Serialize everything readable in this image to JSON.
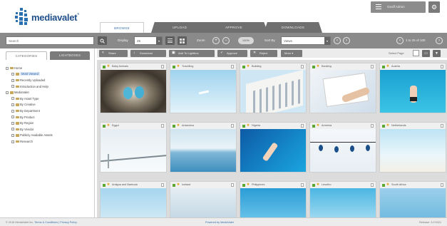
{
  "app": {
    "logo_text": "mediavalet",
    "logo_tm": "®"
  },
  "header": {
    "user_menu_label": "Geoff Admin",
    "tabs": [
      {
        "label": "BROWSE",
        "active": true
      },
      {
        "label": "UPLOAD",
        "active": false
      },
      {
        "label": "APPROVE",
        "active": false
      },
      {
        "label": "DOWNLOADS",
        "active": false
      }
    ]
  },
  "toolbar": {
    "search_placeholder": "Search",
    "display_label": "Display",
    "display_value": "25",
    "zoom_label": "Zoom",
    "zoom_value": "100%",
    "sort_label": "Sort By",
    "sort_value": "Views",
    "paging": "1 to 25 of 100"
  },
  "sidebar": {
    "tabs": [
      {
        "label": "CATEGORIES",
        "active": true
      },
      {
        "label": "LIGHTBOXES",
        "active": false
      }
    ],
    "tree": [
      {
        "label": "Home",
        "level": 0,
        "selected": false
      },
      {
        "label": "Most Viewed",
        "level": 1,
        "selected": true
      },
      {
        "label": "Recently Uploaded",
        "level": 1,
        "selected": false
      },
      {
        "label": "Introduction and Help",
        "level": 1,
        "selected": false
      },
      {
        "label": "MediaValet",
        "level": 0,
        "selected": false
      },
      {
        "label": "By Asset Type",
        "level": 1,
        "selected": false
      },
      {
        "label": "By Creative",
        "level": 1,
        "selected": false
      },
      {
        "label": "By Department",
        "level": 1,
        "selected": false
      },
      {
        "label": "By Product",
        "level": 1,
        "selected": false
      },
      {
        "label": "By Region",
        "level": 1,
        "selected": false
      },
      {
        "label": "By Vendor",
        "level": 1,
        "selected": false
      },
      {
        "label": "Publicly Available Assets",
        "level": 1,
        "selected": false
      },
      {
        "label": "Research",
        "level": 1,
        "selected": false
      }
    ]
  },
  "actions": {
    "buttons": [
      {
        "label": "Share",
        "icon": "share-icon",
        "glyph": "<"
      },
      {
        "label": "Download",
        "icon": "download-icon",
        "glyph": "↓"
      },
      {
        "label": "Add To Lightbox",
        "icon": "lightbox-icon",
        "glyph": "▣"
      },
      {
        "label": "Approve",
        "icon": "check-icon",
        "glyph": "✓"
      },
      {
        "label": "Reject",
        "icon": "reject-icon",
        "glyph": "✕"
      },
      {
        "label": "More",
        "icon": "more-icon",
        "glyph": ""
      }
    ],
    "select_page_label": "Select Page"
  },
  "assets": [
    {
      "title": "Baby Animals",
      "theme": "nest"
    },
    {
      "title": "Travelling",
      "theme": "sky"
    },
    {
      "title": "Building",
      "theme": "building"
    },
    {
      "title": "Banking",
      "theme": "desk"
    },
    {
      "title": "Austria",
      "theme": "pool"
    },
    {
      "title": "Egypt",
      "theme": "bridge"
    },
    {
      "title": "Antarctica",
      "theme": "sea"
    },
    {
      "title": "Nigeria",
      "theme": "dive"
    },
    {
      "title": "Armenia",
      "theme": "bulbs"
    },
    {
      "title": "Netherlands",
      "theme": "beach"
    },
    {
      "title": "Antigua and Barbuda",
      "theme": "pale"
    },
    {
      "title": "Iceland",
      "theme": "ice"
    },
    {
      "title": "Philippines",
      "theme": "wave"
    },
    {
      "title": "Lesotho",
      "theme": "water"
    },
    {
      "title": "South Africa",
      "theme": "coast"
    }
  ],
  "footer": {
    "copyright": "© 2016 MediaValet Inc.",
    "links": "Terms & Conditions | Privacy Policy",
    "powered": "Powered by MediaValet",
    "release": "Release: 3.0.5321"
  },
  "colors": {
    "toolbar": "#8a8a8a",
    "accent": "#2a62a8",
    "approved": "#5aa832",
    "star": "#e8a317"
  }
}
